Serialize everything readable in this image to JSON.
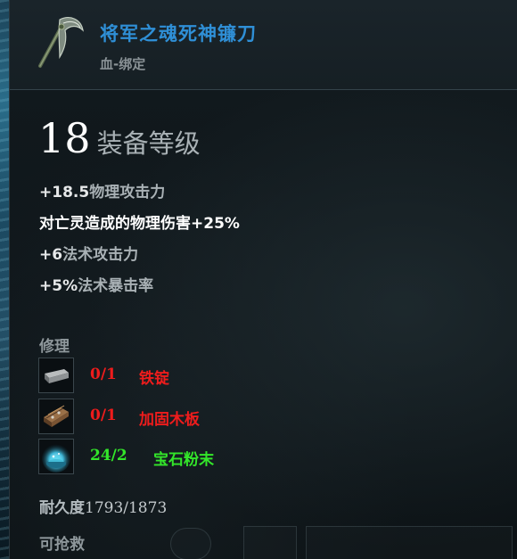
{
  "item": {
    "name": "将军之魂死神镰刀",
    "binding": "血-绑定",
    "icon": "scythe-icon"
  },
  "level": {
    "value": "18",
    "label": "装备等级"
  },
  "stats": [
    {
      "num": "+18.5",
      "text": "物理攻击力",
      "highlight": false
    },
    {
      "num": "",
      "text": "对亡灵造成的物理伤害+25%",
      "highlight": true
    },
    {
      "num": "+6",
      "text": "法术攻击力",
      "highlight": false
    },
    {
      "num": "+5%",
      "text": "法术暴击率",
      "highlight": false
    }
  ],
  "repair": {
    "title": "修理",
    "materials": [
      {
        "count": "0/1",
        "name": "铁锭",
        "icon": "iron-ingot-icon",
        "status_color": "#ee1c1c"
      },
      {
        "count": "0/1",
        "name": "加固木板",
        "icon": "wood-plank-icon",
        "status_color": "#ee1c1c"
      },
      {
        "count": "24/2",
        "name": "宝石粉末",
        "icon": "gem-powder-icon",
        "status_color": "#33e62a"
      }
    ]
  },
  "durability": {
    "label": "耐久度",
    "value": "1793/1873"
  },
  "salvage": {
    "label": "可抢救"
  },
  "colors": {
    "item_name": "#2f8fd6",
    "insufficient": "#ee1c1c",
    "sufficient": "#33e62a"
  }
}
